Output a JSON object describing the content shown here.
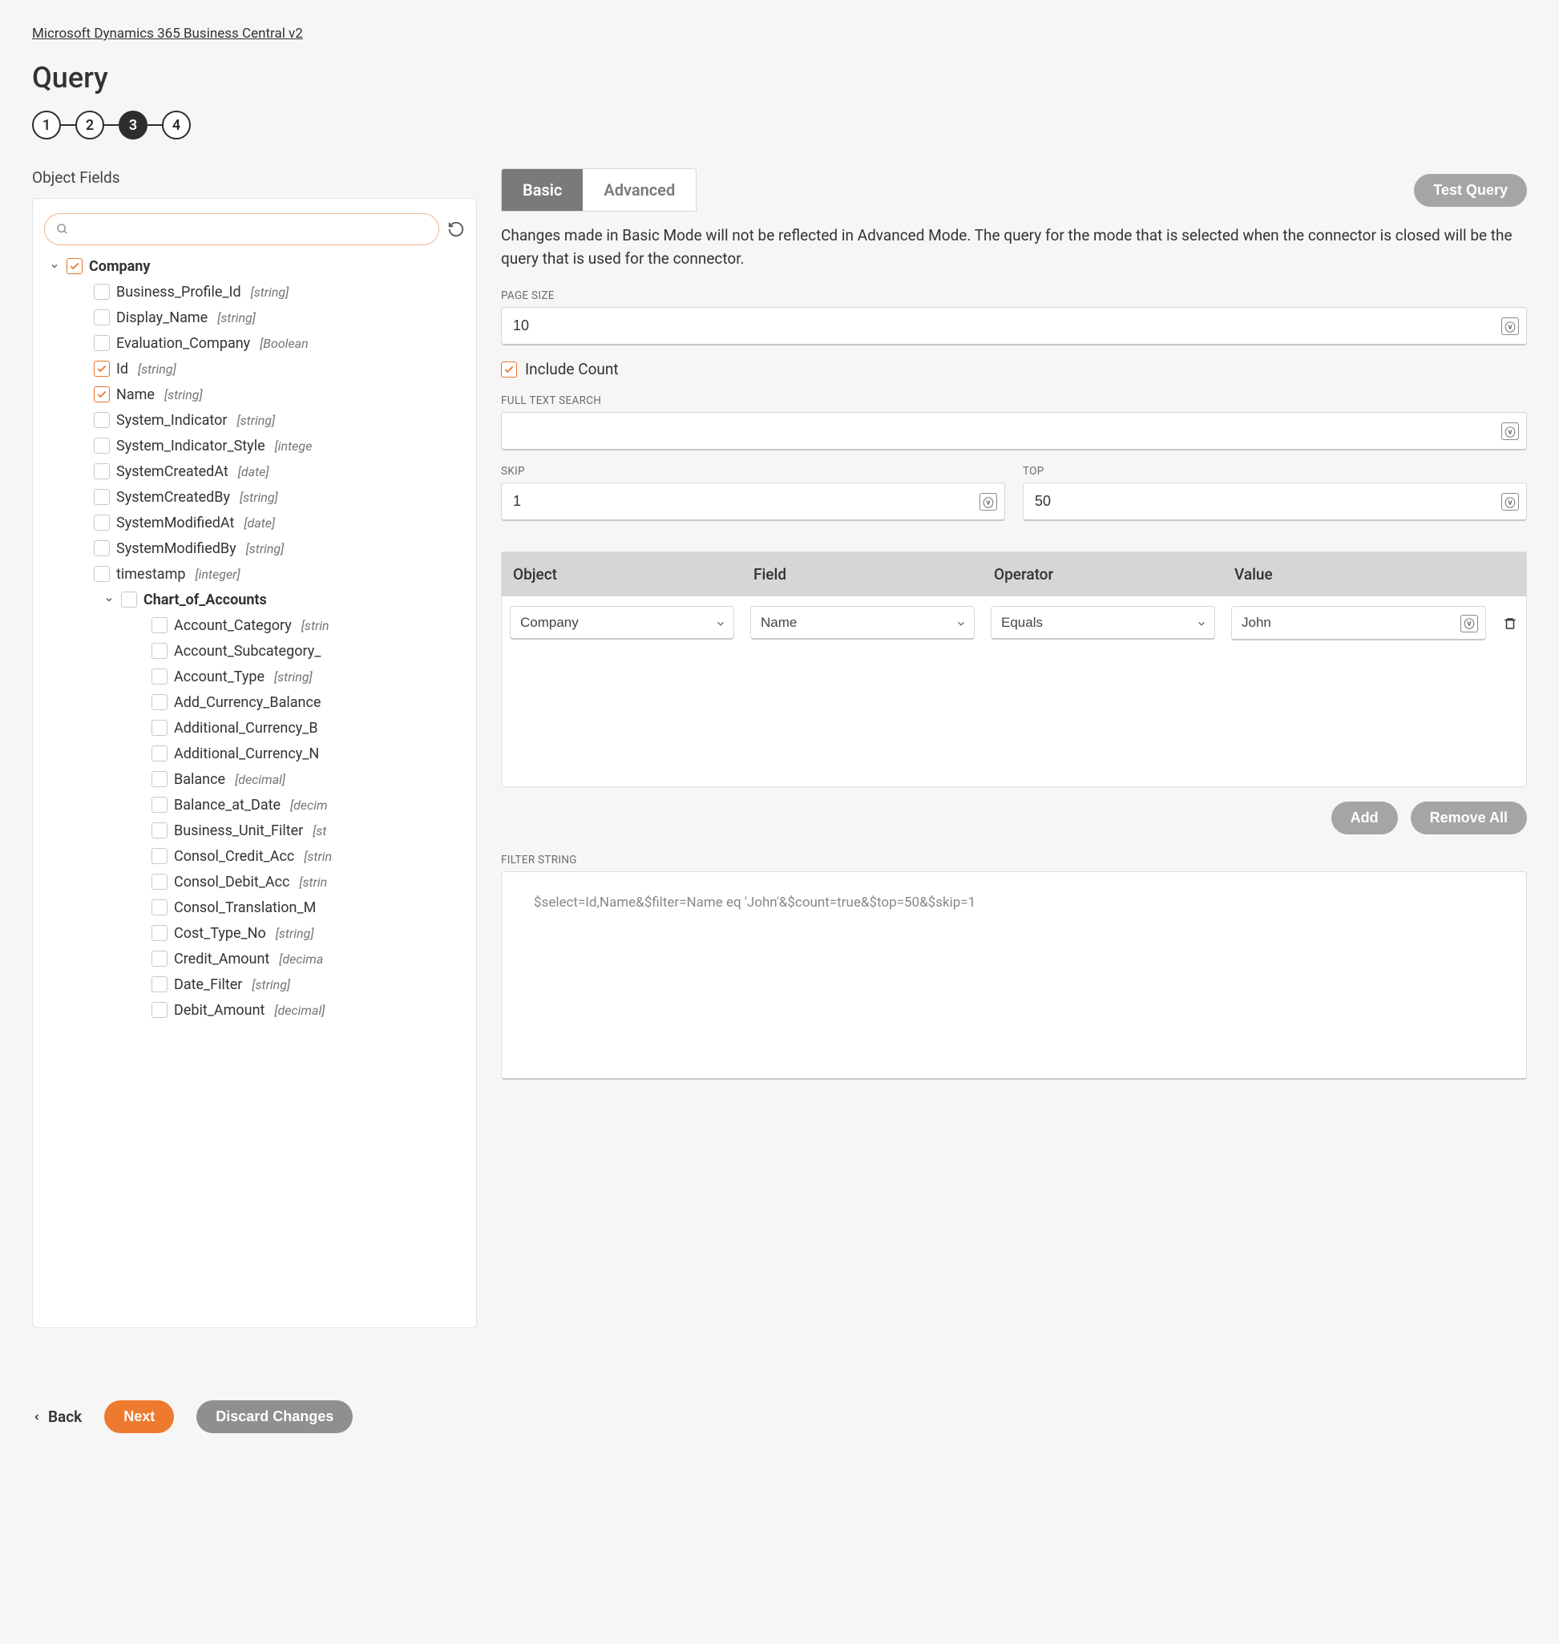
{
  "breadcrumb": "Microsoft Dynamics 365 Business Central v2",
  "page_title": "Query",
  "stepper": {
    "steps": [
      "1",
      "2",
      "3",
      "4"
    ],
    "active": 2
  },
  "sidebar_title": "Object Fields",
  "search_placeholder": "",
  "tree": [
    {
      "depth": 0,
      "caret": "down",
      "checked": true,
      "label": "Company",
      "type": null,
      "bold": true
    },
    {
      "depth": 1,
      "caret": null,
      "checked": false,
      "label": "Business_Profile_Id",
      "type": "[string]",
      "bold": false
    },
    {
      "depth": 1,
      "caret": null,
      "checked": false,
      "label": "Display_Name",
      "type": "[string]",
      "bold": false
    },
    {
      "depth": 1,
      "caret": null,
      "checked": false,
      "label": "Evaluation_Company",
      "type": "[Boolean",
      "bold": false
    },
    {
      "depth": 1,
      "caret": null,
      "checked": true,
      "label": "Id",
      "type": "[string]",
      "bold": false
    },
    {
      "depth": 1,
      "caret": null,
      "checked": true,
      "label": "Name",
      "type": "[string]",
      "bold": false
    },
    {
      "depth": 1,
      "caret": null,
      "checked": false,
      "label": "System_Indicator",
      "type": "[string]",
      "bold": false
    },
    {
      "depth": 1,
      "caret": null,
      "checked": false,
      "label": "System_Indicator_Style",
      "type": "[intege",
      "bold": false
    },
    {
      "depth": 1,
      "caret": null,
      "checked": false,
      "label": "SystemCreatedAt",
      "type": "[date]",
      "bold": false
    },
    {
      "depth": 1,
      "caret": null,
      "checked": false,
      "label": "SystemCreatedBy",
      "type": "[string]",
      "bold": false
    },
    {
      "depth": 1,
      "caret": null,
      "checked": false,
      "label": "SystemModifiedAt",
      "type": "[date]",
      "bold": false
    },
    {
      "depth": 1,
      "caret": null,
      "checked": false,
      "label": "SystemModifiedBy",
      "type": "[string]",
      "bold": false
    },
    {
      "depth": 1,
      "caret": null,
      "checked": false,
      "label": "timestamp",
      "type": "[integer]",
      "bold": false
    },
    {
      "depth": 2,
      "caret": "down",
      "checked": false,
      "label": "Chart_of_Accounts",
      "type": null,
      "bold": true
    },
    {
      "depth": 3,
      "caret": null,
      "checked": false,
      "label": "Account_Category",
      "type": "[strin",
      "bold": false
    },
    {
      "depth": 3,
      "caret": null,
      "checked": false,
      "label": "Account_Subcategory_",
      "type": null,
      "bold": false
    },
    {
      "depth": 3,
      "caret": null,
      "checked": false,
      "label": "Account_Type",
      "type": "[string]",
      "bold": false
    },
    {
      "depth": 3,
      "caret": null,
      "checked": false,
      "label": "Add_Currency_Balance",
      "type": null,
      "bold": false
    },
    {
      "depth": 3,
      "caret": null,
      "checked": false,
      "label": "Additional_Currency_B",
      "type": null,
      "bold": false
    },
    {
      "depth": 3,
      "caret": null,
      "checked": false,
      "label": "Additional_Currency_N",
      "type": null,
      "bold": false
    },
    {
      "depth": 3,
      "caret": null,
      "checked": false,
      "label": "Balance",
      "type": "[decimal]",
      "bold": false
    },
    {
      "depth": 3,
      "caret": null,
      "checked": false,
      "label": "Balance_at_Date",
      "type": "[decim",
      "bold": false
    },
    {
      "depth": 3,
      "caret": null,
      "checked": false,
      "label": "Business_Unit_Filter",
      "type": "[st",
      "bold": false
    },
    {
      "depth": 3,
      "caret": null,
      "checked": false,
      "label": "Consol_Credit_Acc",
      "type": "[strin",
      "bold": false
    },
    {
      "depth": 3,
      "caret": null,
      "checked": false,
      "label": "Consol_Debit_Acc",
      "type": "[strin",
      "bold": false
    },
    {
      "depth": 3,
      "caret": null,
      "checked": false,
      "label": "Consol_Translation_M",
      "type": null,
      "bold": false
    },
    {
      "depth": 3,
      "caret": null,
      "checked": false,
      "label": "Cost_Type_No",
      "type": "[string]",
      "bold": false
    },
    {
      "depth": 3,
      "caret": null,
      "checked": false,
      "label": "Credit_Amount",
      "type": "[decima",
      "bold": false
    },
    {
      "depth": 3,
      "caret": null,
      "checked": false,
      "label": "Date_Filter",
      "type": "[string]",
      "bold": false
    },
    {
      "depth": 3,
      "caret": null,
      "checked": false,
      "label": "Debit_Amount",
      "type": "[decimal]",
      "bold": false
    }
  ],
  "tabs": {
    "basic": "Basic",
    "advanced": "Advanced"
  },
  "test_query": "Test Query",
  "intro": "Changes made in Basic Mode will not be reflected in Advanced Mode. The query for the mode that is selected when the connector is closed will be the query that is used for the connector.",
  "labels": {
    "page_size": "PAGE SIZE",
    "include_count": "Include Count",
    "full_text": "FULL TEXT SEARCH",
    "skip": "SKIP",
    "top": "TOP",
    "filter_string": "FILTER STRING"
  },
  "values": {
    "page_size": "10",
    "include_count_checked": true,
    "full_text": "",
    "skip": "1",
    "top": "50",
    "filter_string": "$select=Id,Name&$filter=Name eq 'John'&$count=true&$top=50&$skip=1"
  },
  "filter_columns": {
    "object": "Object",
    "field": "Field",
    "operator": "Operator",
    "value": "Value"
  },
  "filter_row": {
    "object": "Company",
    "field": "Name",
    "operator": "Equals",
    "value": "John"
  },
  "buttons": {
    "add": "Add",
    "remove_all": "Remove All",
    "back": "Back",
    "next": "Next",
    "discard": "Discard Changes"
  }
}
